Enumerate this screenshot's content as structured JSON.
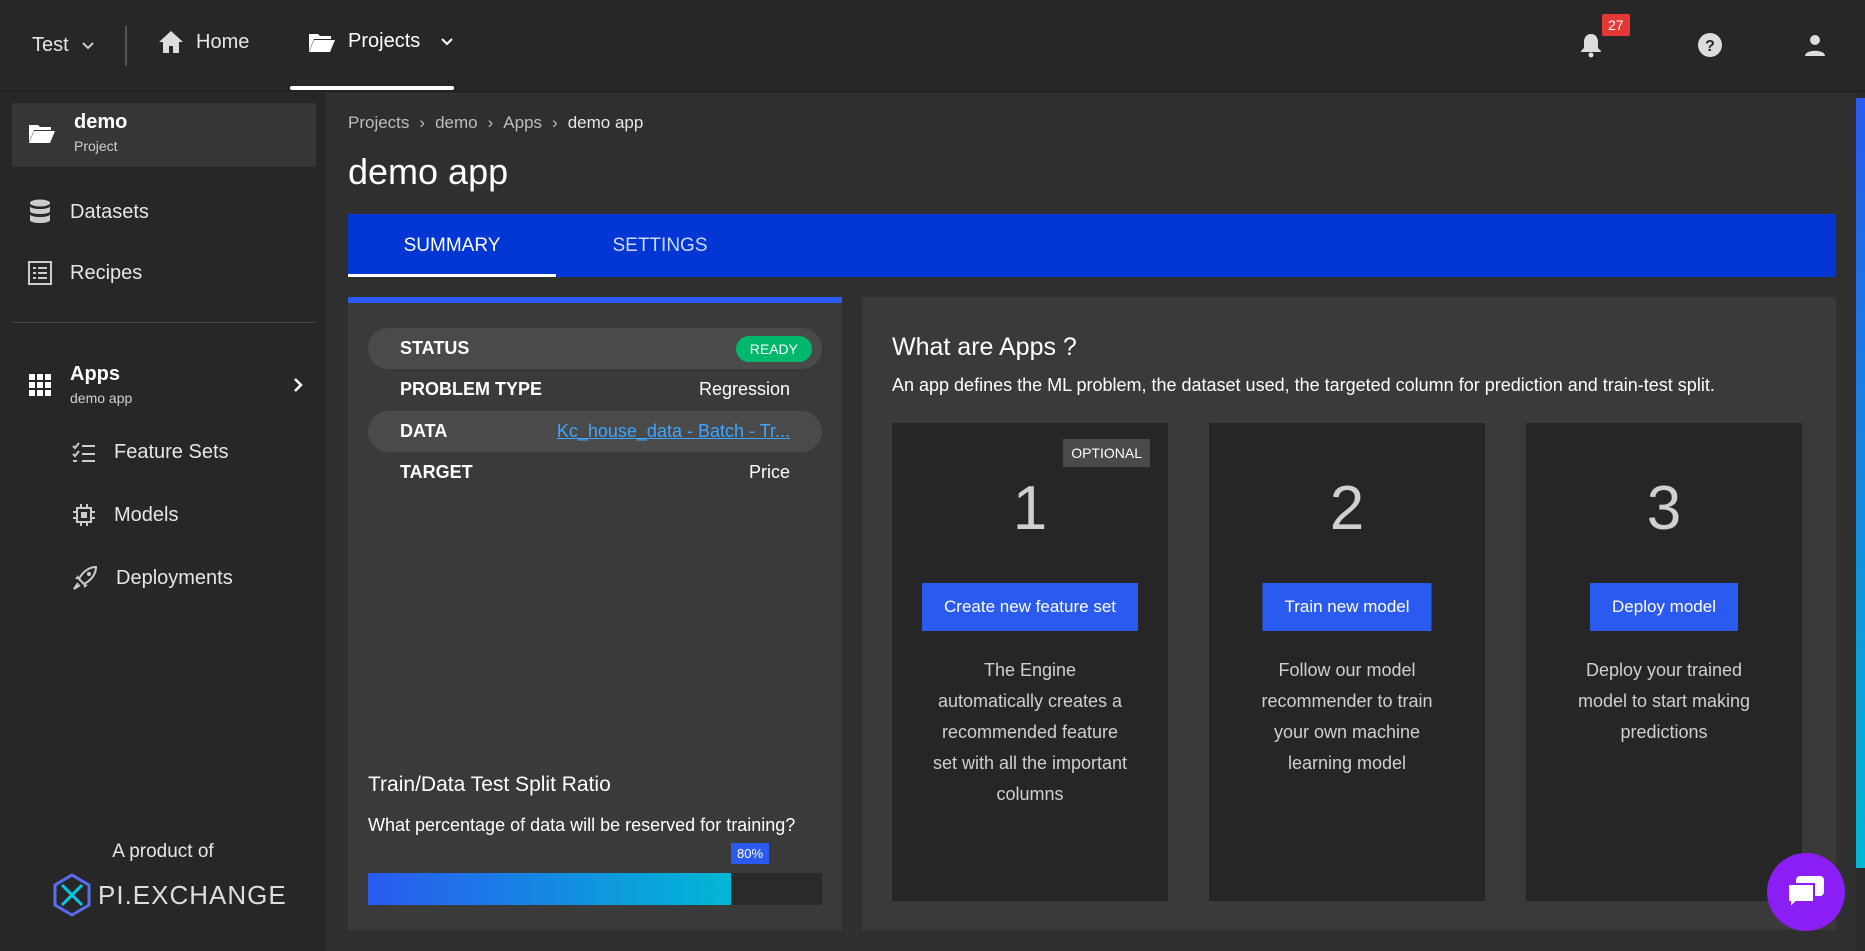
{
  "topbar": {
    "workspace": "Test",
    "home_label": "Home",
    "projects_label": "Projects",
    "notification_count": "27"
  },
  "sidebar": {
    "project_name": "demo",
    "project_sub": "Project",
    "datasets": "Datasets",
    "recipes": "Recipes",
    "apps": "Apps",
    "apps_sub": "demo app",
    "feature_sets": "Feature Sets",
    "models": "Models",
    "deployments": "Deployments",
    "product_of": "A product of",
    "logo_text": "PI.EXCHANGE"
  },
  "breadcrumb": [
    "Projects",
    "demo",
    "Apps",
    "demo app"
  ],
  "page_title": "demo app",
  "tabs": {
    "summary": "SUMMARY",
    "settings": "SETTINGS"
  },
  "summary": {
    "status_label": "STATUS",
    "status_value": "READY",
    "problem_type_label": "PROBLEM TYPE",
    "problem_type_value": "Regression",
    "data_label": "DATA",
    "data_value": "Kc_house_data - Batch - Tr...",
    "target_label": "TARGET",
    "target_value": "Price",
    "split_title": "Train/Data Test Split Ratio",
    "split_question": "What percentage of data will be reserved for training?",
    "split_label": "80%",
    "split_fraction": 0.8
  },
  "apps_info": {
    "title": "What are Apps ?",
    "description": "An app defines the ML problem, the dataset used, the targeted column for prediction and train-test split.",
    "cards": [
      {
        "num": "1",
        "tag": "OPTIONAL",
        "button": "Create new feature set",
        "text": "The Engine automatically creates a recommended feature set with all the important columns"
      },
      {
        "num": "2",
        "button": "Train new model",
        "text": "Follow our model recommender to train your own machine learning model"
      },
      {
        "num": "3",
        "button": "Deploy model",
        "text": "Deploy your trained model to start making predictions"
      }
    ]
  },
  "colors": {
    "accent": "#2a5af0",
    "tabbar": "#0037d4",
    "ready": "#00b86b",
    "chat": "#8a1ef5"
  }
}
